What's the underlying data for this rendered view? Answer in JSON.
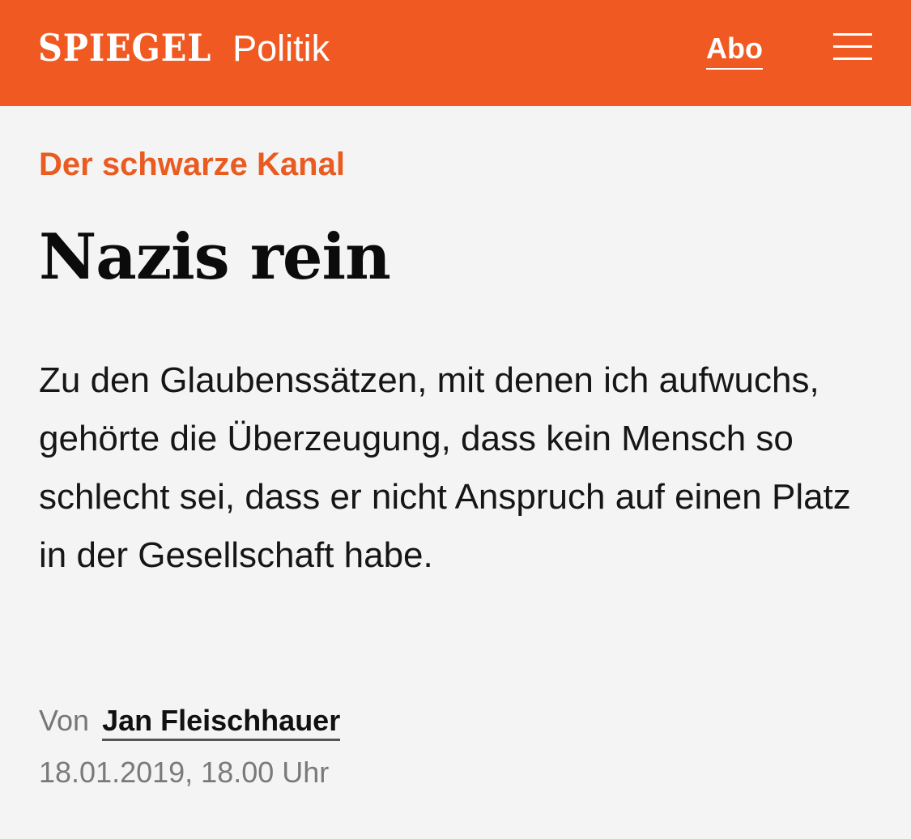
{
  "header": {
    "logo_text": "SPIEGEL",
    "section": "Politik",
    "abo_label": "Abo",
    "menu_icon": "hamburger-menu-icon",
    "background_color": "#f05a22"
  },
  "article": {
    "kicker": "Der schwarze Kanal",
    "headline": "Nazis rein",
    "lead": "Zu den Glaubenssätzen, mit denen ich aufwuchs, gehörte die Überzeugung, dass kein Mensch so schlecht sei, dass er nicht Anspruch auf einen Platz in der Gesellschaft habe.",
    "byline_prefix": "Von",
    "author": "Jan Fleischhauer",
    "date": "18.01.2019, 18.00 Uhr",
    "kicker_color": "#ea5b21"
  }
}
